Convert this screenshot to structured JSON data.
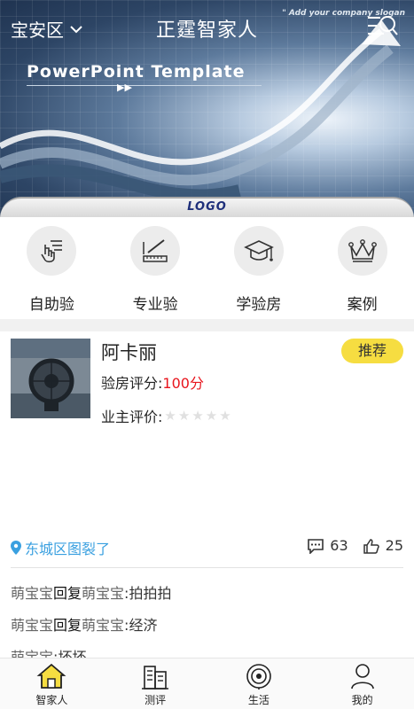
{
  "header": {
    "location": "宝安区",
    "title": "正霆智家人",
    "slogan": "\" Add your company slogan"
  },
  "banner": {
    "ppt_title": "PowerPoint Template",
    "ppt_arrows": "▶▶",
    "logo": "LOGO"
  },
  "quick_actions": [
    {
      "label": "自助验",
      "icon": "hand-list-icon"
    },
    {
      "label": "专业验",
      "icon": "ruler-pen-icon"
    },
    {
      "label": "学验房",
      "icon": "graduation-cap-icon"
    },
    {
      "label": "案例",
      "icon": "crown-icon"
    }
  ],
  "card": {
    "name": "阿卡丽",
    "badge": "推荐",
    "score_label": "验房评分:",
    "score_value": "100分",
    "owner_label": "业主评价:",
    "owner_rating": 0,
    "place": "东城区图裂了",
    "comments_count": "63",
    "likes_count": "25",
    "comments": [
      {
        "user": "萌宝宝",
        "reply": "回复",
        "target": "萌宝宝",
        "text": ":拍拍拍"
      },
      {
        "user": "萌宝宝",
        "reply": "回复",
        "target": "萌宝宝",
        "text": ":经济"
      },
      {
        "user": "萌宝宝",
        "reply": "",
        "target": "",
        "text": ":坏坏"
      }
    ]
  },
  "nav": [
    {
      "label": "智家人",
      "icon": "home-icon",
      "active": true
    },
    {
      "label": "测评",
      "icon": "building-icon",
      "active": false
    },
    {
      "label": "生活",
      "icon": "target-icon",
      "active": false
    },
    {
      "label": "我的",
      "icon": "person-icon",
      "active": false
    }
  ],
  "colors": {
    "accent_yellow": "#f6dd41",
    "score_red": "#e8151d",
    "place_blue": "#3aa0e0",
    "logo_blue": "#1e2f7a"
  }
}
